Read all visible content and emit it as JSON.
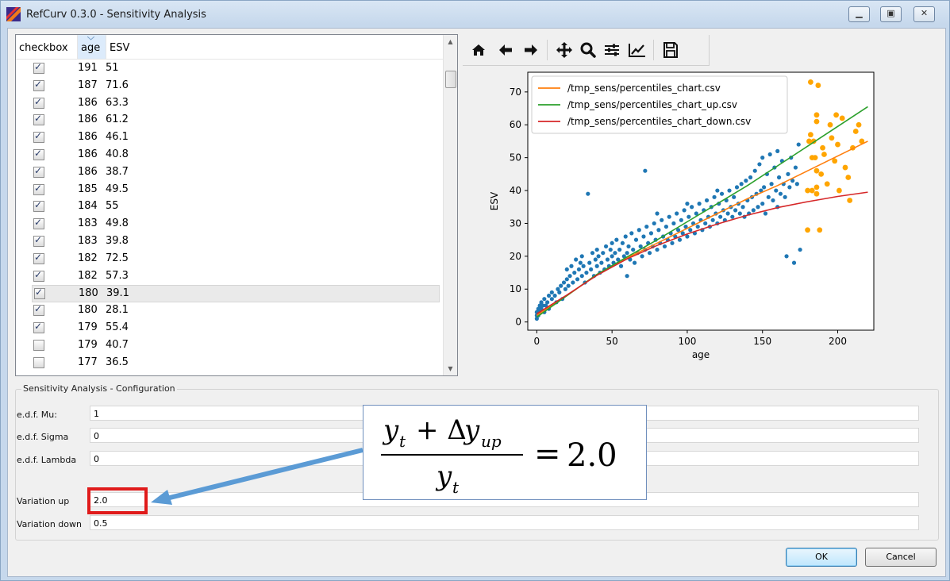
{
  "window": {
    "title": "RefCurv 0.3.0 - Sensitivity Analysis"
  },
  "table": {
    "columns": [
      "checkbox",
      "age",
      "ESV"
    ],
    "rows": [
      {
        "checked": true,
        "age": "191",
        "esv": "51"
      },
      {
        "checked": true,
        "age": "187",
        "esv": "71.6"
      },
      {
        "checked": true,
        "age": "186",
        "esv": "63.3"
      },
      {
        "checked": true,
        "age": "186",
        "esv": "61.2"
      },
      {
        "checked": true,
        "age": "186",
        "esv": "46.1"
      },
      {
        "checked": true,
        "age": "186",
        "esv": "40.8"
      },
      {
        "checked": true,
        "age": "186",
        "esv": "38.7"
      },
      {
        "checked": true,
        "age": "185",
        "esv": "49.5"
      },
      {
        "checked": true,
        "age": "184",
        "esv": "55"
      },
      {
        "checked": true,
        "age": "183",
        "esv": "49.8"
      },
      {
        "checked": true,
        "age": "183",
        "esv": "39.8"
      },
      {
        "checked": true,
        "age": "182",
        "esv": "72.5"
      },
      {
        "checked": true,
        "age": "182",
        "esv": "57.3"
      },
      {
        "checked": true,
        "age": "180",
        "esv": "39.1",
        "selected": true
      },
      {
        "checked": true,
        "age": "180",
        "esv": "28.1"
      },
      {
        "checked": true,
        "age": "179",
        "esv": "55.4"
      },
      {
        "checked": false,
        "age": "179",
        "esv": "40.7"
      },
      {
        "checked": false,
        "age": "177",
        "esv": "36.5"
      }
    ]
  },
  "toolbar": {
    "icons": [
      "home-icon",
      "back-arrow-icon",
      "forward-arrow-icon",
      "pan-icon",
      "zoom-icon",
      "subplots-config-icon",
      "edit-axis-icon",
      "save-icon"
    ]
  },
  "config": {
    "group_title": "Sensitivity Analysis - Configuration",
    "fields": [
      {
        "label": "e.d.f. Mu:",
        "value": "1"
      },
      {
        "label": "e.d.f. Sigma",
        "value": "0"
      },
      {
        "label": "e.d.f. Lambda",
        "value": "0"
      },
      {
        "label": "Variation up",
        "value": "2.0"
      },
      {
        "label": "Variation down",
        "value": "0.5"
      }
    ]
  },
  "annotation": {
    "formula_result": "2.0"
  },
  "buttons": {
    "ok": "OK",
    "cancel": "Cancel"
  },
  "colors": {
    "scatter_blue": "#1f77b4",
    "scatter_orange": "#ffa500",
    "median_line": "#ff7f0e",
    "up_line": "#2ca02c",
    "down_line": "#d62728",
    "highlight_red": "#e01b1b",
    "annotation_arrow": "#5b9bd5"
  },
  "chart_data": {
    "type": "scatter",
    "xlabel": "age",
    "ylabel": "ESV",
    "xlim": [
      -6,
      224
    ],
    "ylim": [
      -2.5,
      76
    ],
    "xticks": [
      0,
      50,
      100,
      150,
      200
    ],
    "yticks": [
      0,
      10,
      20,
      30,
      40,
      50,
      60,
      70
    ],
    "legend_position": "top-left",
    "lines": [
      {
        "name": "/tmp_sens/percentiles_chart.csv",
        "color": "#ff7f0e",
        "x": [
          0,
          20,
          40,
          60,
          80,
          100,
          120,
          140,
          160,
          180,
          200,
          220
        ],
        "y": [
          2,
          8,
          14.5,
          19.5,
          24,
          28.5,
          33,
          37.5,
          41.5,
          46,
          50.5,
          55
        ]
      },
      {
        "name": "/tmp_sens/percentiles_chart_up.csv",
        "color": "#2ca02c",
        "x": [
          0,
          20,
          40,
          60,
          80,
          100,
          120,
          140,
          160,
          180,
          200,
          220
        ],
        "y": [
          1.5,
          8,
          14.5,
          19.8,
          25,
          30.5,
          36,
          41.5,
          47.5,
          53.5,
          59.5,
          65.5
        ]
      },
      {
        "name": "/tmp_sens/percentiles_chart_down.csv",
        "color": "#d62728",
        "x": [
          0,
          20,
          40,
          60,
          80,
          100,
          120,
          140,
          160,
          180,
          200,
          220
        ],
        "y": [
          2.5,
          8.2,
          14.2,
          19.2,
          23.3,
          26.8,
          29.8,
          32.5,
          34.8,
          36.6,
          38.2,
          39.5
        ]
      }
    ],
    "points_blue": [
      [
        0,
        1
      ],
      [
        0,
        2
      ],
      [
        0,
        3
      ],
      [
        1,
        2
      ],
      [
        1,
        4
      ],
      [
        2,
        3
      ],
      [
        2,
        5
      ],
      [
        3,
        4
      ],
      [
        3,
        6
      ],
      [
        4,
        5
      ],
      [
        5,
        3
      ],
      [
        5,
        7
      ],
      [
        6,
        5
      ],
      [
        7,
        6
      ],
      [
        8,
        4
      ],
      [
        8,
        8
      ],
      [
        10,
        7
      ],
      [
        10,
        9
      ],
      [
        12,
        8
      ],
      [
        13,
        6
      ],
      [
        14,
        10
      ],
      [
        15,
        9
      ],
      [
        16,
        11
      ],
      [
        17,
        7
      ],
      [
        18,
        12
      ],
      [
        19,
        10
      ],
      [
        20,
        13
      ],
      [
        20,
        16
      ],
      [
        21,
        11
      ],
      [
        22,
        14
      ],
      [
        23,
        17
      ],
      [
        24,
        12
      ],
      [
        25,
        15
      ],
      [
        26,
        19
      ],
      [
        27,
        13
      ],
      [
        28,
        16
      ],
      [
        29,
        18
      ],
      [
        30,
        14
      ],
      [
        30,
        20
      ],
      [
        31,
        17
      ],
      [
        32,
        12
      ],
      [
        33,
        15
      ],
      [
        34,
        39
      ],
      [
        35,
        18
      ],
      [
        36,
        16
      ],
      [
        37,
        21
      ],
      [
        38,
        14
      ],
      [
        39,
        19
      ],
      [
        40,
        17
      ],
      [
        40,
        22
      ],
      [
        41,
        20
      ],
      [
        42,
        15
      ],
      [
        43,
        18
      ],
      [
        44,
        21
      ],
      [
        45,
        16
      ],
      [
        46,
        23
      ],
      [
        47,
        19
      ],
      [
        48,
        17
      ],
      [
        49,
        22
      ],
      [
        50,
        20
      ],
      [
        50,
        24
      ],
      [
        51,
        18
      ],
      [
        52,
        21
      ],
      [
        53,
        25
      ],
      [
        54,
        19
      ],
      [
        55,
        22
      ],
      [
        56,
        17
      ],
      [
        57,
        24
      ],
      [
        58,
        20
      ],
      [
        59,
        26
      ],
      [
        60,
        21
      ],
      [
        60,
        14
      ],
      [
        61,
        23
      ],
      [
        62,
        19
      ],
      [
        63,
        27
      ],
      [
        64,
        22
      ],
      [
        65,
        18
      ],
      [
        66,
        25
      ],
      [
        67,
        21
      ],
      [
        68,
        28
      ],
      [
        69,
        23
      ],
      [
        70,
        20
      ],
      [
        71,
        26
      ],
      [
        72,
        46
      ],
      [
        72,
        22
      ],
      [
        73,
        29
      ],
      [
        74,
        24
      ],
      [
        75,
        21
      ],
      [
        76,
        27
      ],
      [
        77,
        23
      ],
      [
        78,
        30
      ],
      [
        79,
        25
      ],
      [
        80,
        22
      ],
      [
        80,
        33
      ],
      [
        81,
        28
      ],
      [
        82,
        24
      ],
      [
        83,
        31
      ],
      [
        84,
        26
      ],
      [
        85,
        23
      ],
      [
        86,
        29
      ],
      [
        87,
        25
      ],
      [
        88,
        32
      ],
      [
        89,
        27
      ],
      [
        90,
        24
      ],
      [
        91,
        30
      ],
      [
        92,
        26
      ],
      [
        93,
        33
      ],
      [
        94,
        28
      ],
      [
        95,
        25
      ],
      [
        96,
        31
      ],
      [
        97,
        27
      ],
      [
        98,
        34
      ],
      [
        99,
        29
      ],
      [
        100,
        26
      ],
      [
        100,
        36
      ],
      [
        101,
        32
      ],
      [
        102,
        28
      ],
      [
        103,
        35
      ],
      [
        104,
        30
      ],
      [
        105,
        27
      ],
      [
        106,
        33
      ],
      [
        107,
        29
      ],
      [
        108,
        36
      ],
      [
        109,
        31
      ],
      [
        110,
        28
      ],
      [
        111,
        34
      ],
      [
        112,
        30
      ],
      [
        113,
        37
      ],
      [
        114,
        32
      ],
      [
        115,
        29
      ],
      [
        116,
        35
      ],
      [
        117,
        31
      ],
      [
        118,
        38
      ],
      [
        119,
        33
      ],
      [
        120,
        30
      ],
      [
        120,
        40
      ],
      [
        121,
        36
      ],
      [
        122,
        32
      ],
      [
        123,
        39
      ],
      [
        124,
        34
      ],
      [
        125,
        31
      ],
      [
        126,
        37
      ],
      [
        127,
        33
      ],
      [
        128,
        40
      ],
      [
        129,
        35
      ],
      [
        130,
        32
      ],
      [
        131,
        38
      ],
      [
        132,
        34
      ],
      [
        133,
        41
      ],
      [
        134,
        36
      ],
      [
        135,
        33
      ],
      [
        136,
        42
      ],
      [
        137,
        35
      ],
      [
        138,
        32
      ],
      [
        139,
        43
      ],
      [
        140,
        37
      ],
      [
        141,
        33
      ],
      [
        142,
        44
      ],
      [
        143,
        38
      ],
      [
        144,
        34
      ],
      [
        145,
        46
      ],
      [
        146,
        39
      ],
      [
        147,
        35
      ],
      [
        148,
        48
      ],
      [
        149,
        40
      ],
      [
        150,
        36
      ],
      [
        150,
        50
      ],
      [
        151,
        41
      ],
      [
        152,
        33
      ],
      [
        153,
        45
      ],
      [
        154,
        38
      ],
      [
        155,
        51
      ],
      [
        156,
        42
      ],
      [
        157,
        37
      ],
      [
        158,
        47
      ],
      [
        159,
        40
      ],
      [
        160,
        35
      ],
      [
        160,
        52
      ],
      [
        161,
        44
      ],
      [
        162,
        39
      ],
      [
        163,
        49
      ],
      [
        164,
        42
      ],
      [
        165,
        38
      ],
      [
        166,
        20
      ],
      [
        167,
        45
      ],
      [
        168,
        41
      ],
      [
        169,
        50
      ],
      [
        170,
        43
      ],
      [
        171,
        18
      ],
      [
        172,
        47
      ],
      [
        173,
        42
      ],
      [
        174,
        54
      ],
      [
        175,
        22
      ]
    ],
    "points_orange": [
      [
        180,
        28
      ],
      [
        180,
        40
      ],
      [
        181,
        55
      ],
      [
        182,
        73
      ],
      [
        182,
        57
      ],
      [
        183,
        50
      ],
      [
        183,
        40
      ],
      [
        184,
        55
      ],
      [
        185,
        50
      ],
      [
        186,
        63
      ],
      [
        186,
        61
      ],
      [
        186,
        46
      ],
      [
        186,
        41
      ],
      [
        186,
        39
      ],
      [
        187,
        72
      ],
      [
        188,
        28
      ],
      [
        189,
        45
      ],
      [
        190,
        53
      ],
      [
        191,
        51
      ],
      [
        193,
        42
      ],
      [
        195,
        60
      ],
      [
        196,
        56
      ],
      [
        198,
        49
      ],
      [
        199,
        63
      ],
      [
        200,
        54
      ],
      [
        201,
        40
      ],
      [
        203,
        62
      ],
      [
        205,
        47
      ],
      [
        207,
        44
      ],
      [
        208,
        37
      ],
      [
        210,
        53
      ],
      [
        212,
        58
      ],
      [
        214,
        60
      ],
      [
        216,
        55
      ]
    ]
  }
}
